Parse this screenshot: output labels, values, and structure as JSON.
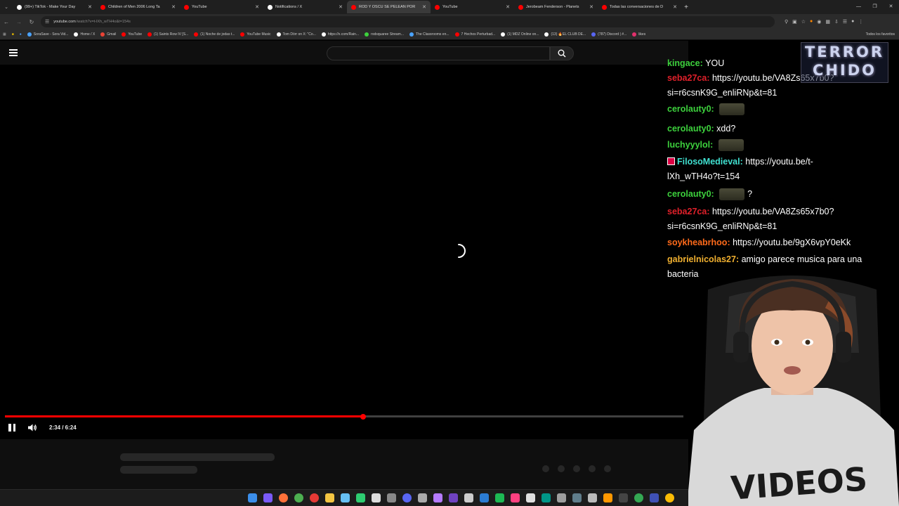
{
  "browser": {
    "tabs": [
      {
        "title": "(99+) TikTok - Make Your Day",
        "color": "#ffffff"
      },
      {
        "title": "Children of Men 2006 Long Ta",
        "color": "#ff0000"
      },
      {
        "title": "YouTube",
        "color": "#ff0000"
      },
      {
        "title": "Notifications / X",
        "color": "#ffffff"
      },
      {
        "title": "ROD Y OSCU SE PELEAN POR",
        "color": "#ff0000"
      },
      {
        "title": "YouTube",
        "color": "#ff0000"
      },
      {
        "title": "Jerobeam Fenderson - Planets",
        "color": "#ff0000"
      },
      {
        "title": "Todas las conversaciones de D",
        "color": "#ff0000"
      }
    ],
    "active_tab_index": 4,
    "url_host": "youtube.com",
    "url_path": "/watch?v=t-lXh_wTH4o&t=154s",
    "bookmarks": [
      {
        "label": "SoraSave - Sora Vid...",
        "color": "#4aa3ff"
      },
      {
        "label": "Home / X",
        "color": "#ffffff"
      },
      {
        "label": "Gmail",
        "color": "#ea4335"
      },
      {
        "label": "YouTube",
        "color": "#ff0000"
      },
      {
        "label": "(1) Saints Row IV [S...",
        "color": "#ff0000"
      },
      {
        "label": "(1) Noche de jodas t...",
        "color": "#ff0000"
      },
      {
        "label": "YouTube Music",
        "color": "#ff0000"
      },
      {
        "label": "Tom Dörr on X: \"Co...",
        "color": "#ffffff"
      },
      {
        "label": "https://x.com/Rain...",
        "color": "#ffffff"
      },
      {
        "label": "rodsquaree Stream...",
        "color": "#3dd13d"
      },
      {
        "label": "The Classrooms en...",
        "color": "#4aa3ff"
      },
      {
        "label": "7 Hechos Perturbad...",
        "color": "#ff0000"
      },
      {
        "label": "(1) MDZ Online on...",
        "color": "#ffffff"
      },
      {
        "label": "(13) 🔥EL CLUB DE...",
        "color": "#ffffff"
      },
      {
        "label": "(787) Discord | #...",
        "color": "#5865f2"
      },
      {
        "label": "likes",
        "color": "#e1306c"
      }
    ],
    "bookmarks_right": "Todos los favoritos"
  },
  "player": {
    "time_display": "2:34 / 6:24",
    "progress_fraction": 0.528
  },
  "chat": [
    {
      "user": "kingace",
      "color": "#3dd13d",
      "text": "YOU",
      "badge": false
    },
    {
      "user": "seba27ca",
      "color": "#e0202a",
      "text": "https://youtu.be/VA8Zs65x7b0?",
      "text2": "si=r6csnK9G_enliRNp&t=81",
      "badge": false
    },
    {
      "user": "cerolauty0",
      "color": "#3dd13d",
      "text": "",
      "emote": true,
      "badge": false
    },
    {
      "user": "cerolauty0",
      "color": "#3dd13d",
      "text": "xdd?",
      "badge": false
    },
    {
      "user": "luchyyylol",
      "color": "#3dd13d",
      "text": "",
      "emote": true,
      "badge": false
    },
    {
      "user": "FilosoMedieval",
      "color": "#40e0d0",
      "text": "https://youtu.be/t-",
      "text2": "lXh_wTH4o?t=154",
      "badge": true
    },
    {
      "user": "cerolauty0",
      "color": "#3dd13d",
      "text": "?",
      "emote": true,
      "badge": false
    },
    {
      "user": "seba27ca",
      "color": "#e0202a",
      "text": "https://youtu.be/VA8Zs65x7b0?",
      "text2": "si=r6csnK9G_enliRNp&t=81",
      "badge": false
    },
    {
      "user": "soykheabrhoo",
      "color": "#ff6a1a",
      "text": "https://youtu.be/9gX6vpY0eKk",
      "badge": false
    },
    {
      "user": "gabrielnicolas27",
      "color": "#f0b030",
      "text": "amigo parece musica para una",
      "text2": "bacteria",
      "badge": false
    }
  ],
  "logo": {
    "line1": "TERROR",
    "line2": "CHIDO"
  },
  "webcam_shirt_text": "VIDEOS",
  "taskbar_icons": [
    {
      "name": "windows-start-icon",
      "color": "#3b8eea"
    },
    {
      "name": "app-icon",
      "color": "#7a5af8"
    },
    {
      "name": "firefox-icon",
      "color": "#ff7139"
    },
    {
      "name": "chrome-icon",
      "color": "#4caf50"
    },
    {
      "name": "chrome-icon",
      "color": "#e53935"
    },
    {
      "name": "file-explorer-icon",
      "color": "#f4c542"
    },
    {
      "name": "steam-icon",
      "color": "#66c0f4"
    },
    {
      "name": "app-icon",
      "color": "#2ecc71"
    },
    {
      "name": "app-icon",
      "color": "#dddddd"
    },
    {
      "name": "app-icon",
      "color": "#888888"
    },
    {
      "name": "discord-icon",
      "color": "#5865f2"
    },
    {
      "name": "app-icon",
      "color": "#aaaaaa"
    },
    {
      "name": "app-icon",
      "color": "#b57bff"
    },
    {
      "name": "app-icon",
      "color": "#6f42c1"
    },
    {
      "name": "app-icon",
      "color": "#cccccc"
    },
    {
      "name": "app-icon",
      "color": "#2b7cd3"
    },
    {
      "name": "app-icon",
      "color": "#1db954"
    },
    {
      "name": "app-icon",
      "color": "#ff4081"
    },
    {
      "name": "app-icon",
      "color": "#e0e0e0"
    },
    {
      "name": "app-icon",
      "color": "#009688"
    },
    {
      "name": "app-icon",
      "color": "#9e9e9e"
    },
    {
      "name": "app-icon",
      "color": "#607d8b"
    },
    {
      "name": "app-icon",
      "color": "#bbbbbb"
    },
    {
      "name": "app-icon",
      "color": "#ff9800"
    },
    {
      "name": "terminal-icon",
      "color": "#444444"
    },
    {
      "name": "chrome-icon",
      "color": "#34a853"
    },
    {
      "name": "app-icon",
      "color": "#3f51b5"
    },
    {
      "name": "chrome-icon",
      "color": "#fbbc05"
    }
  ]
}
